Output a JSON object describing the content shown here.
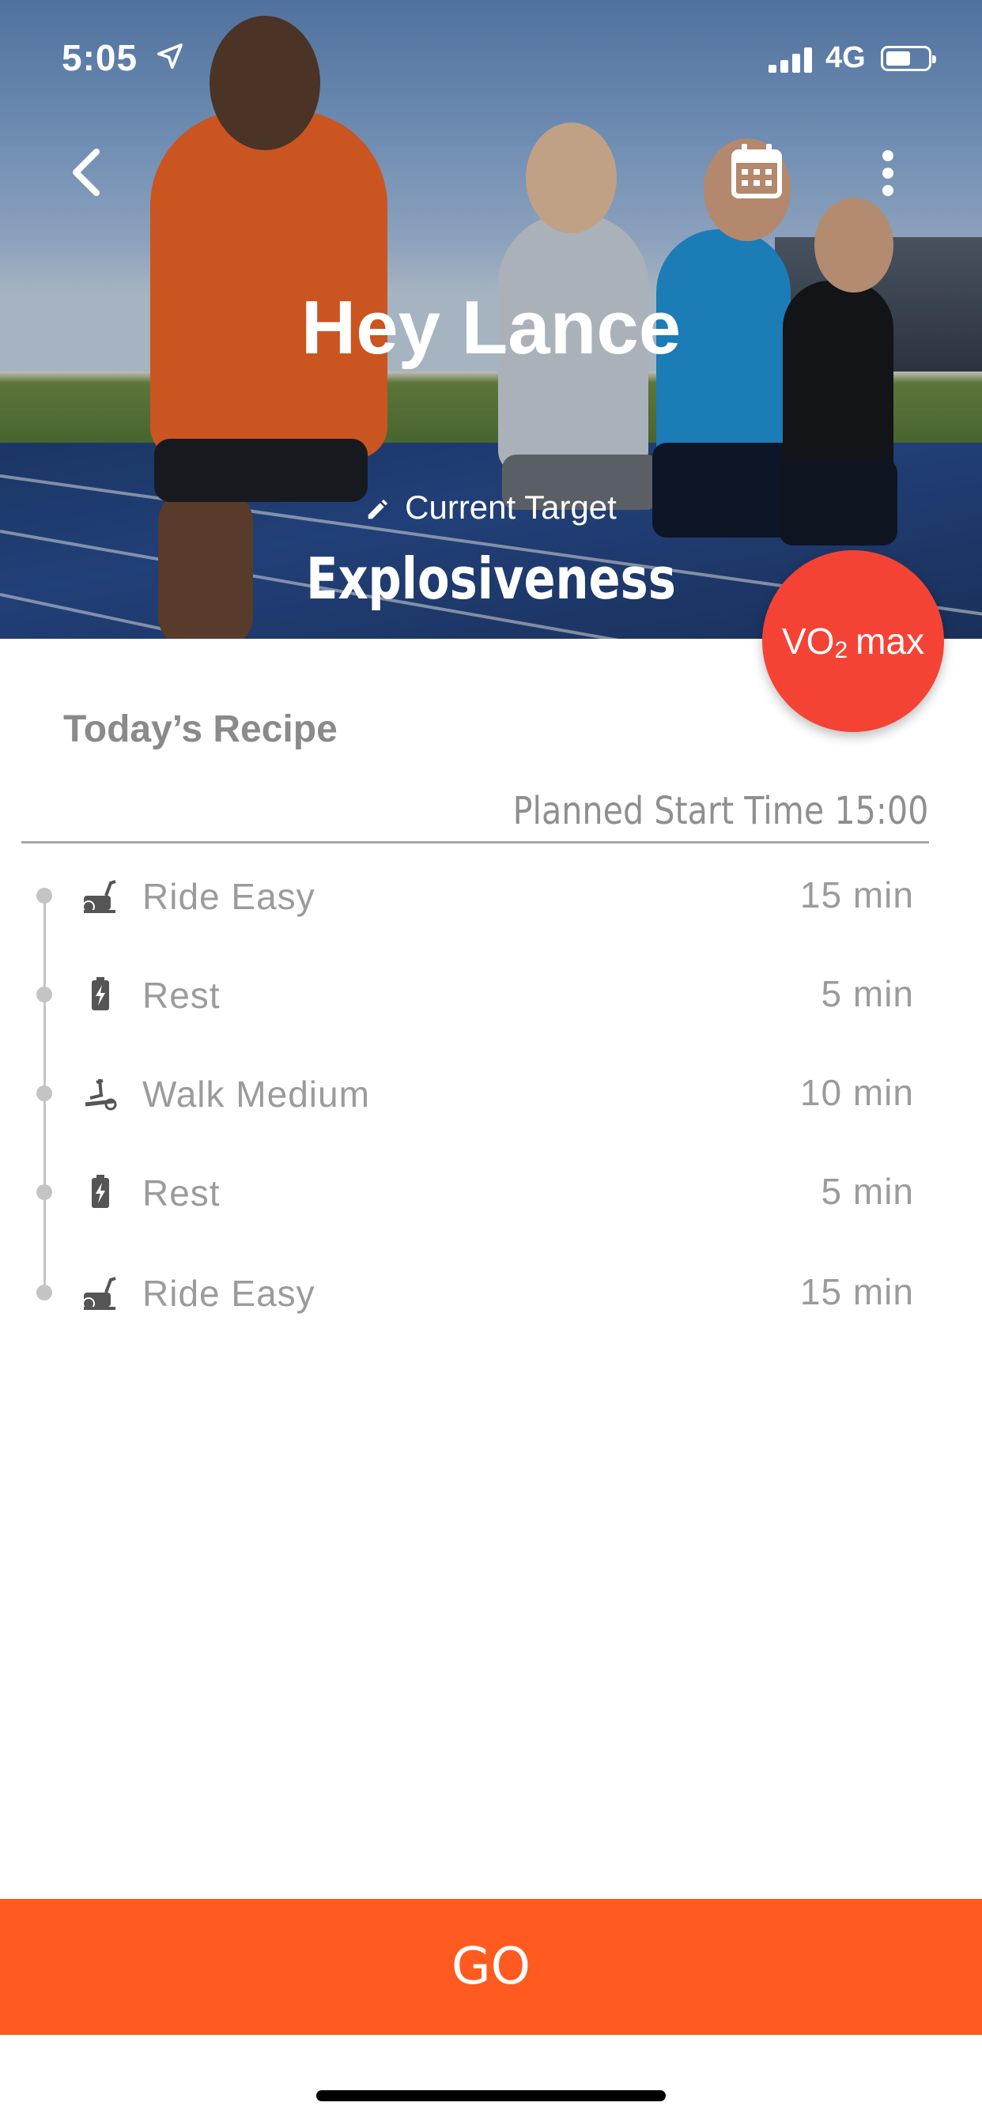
{
  "status_bar": {
    "time": "5:05",
    "network": "4G"
  },
  "header": {
    "greeting": "Hey Lance",
    "target_label": "Current Target",
    "target_value": "Explosiveness",
    "badge_main": "VO",
    "badge_sub": "2",
    "badge_suffix": "max"
  },
  "recipe": {
    "title": "Today’s Recipe",
    "planned_start": "Planned Start Time 15:00",
    "steps": [
      {
        "name": "Ride Easy",
        "duration": "15 min",
        "icon": "bike-icon"
      },
      {
        "name": "Rest",
        "duration": "5 min",
        "icon": "battery-icon"
      },
      {
        "name": "Walk Medium",
        "duration": "10 min",
        "icon": "elliptical-icon"
      },
      {
        "name": "Rest",
        "duration": "5 min",
        "icon": "battery-icon"
      },
      {
        "name": "Ride Easy",
        "duration": "15 min",
        "icon": "bike-icon"
      }
    ]
  },
  "actions": {
    "go_label": "GO"
  },
  "colors": {
    "accent": "#ff5a1f",
    "badge": "#f44335",
    "muted_text": "#9b9b9b"
  }
}
